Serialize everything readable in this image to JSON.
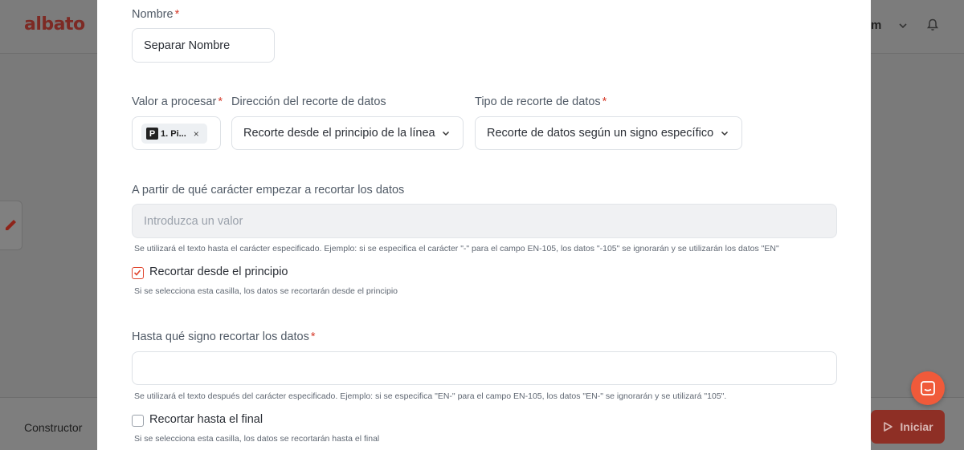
{
  "header": {
    "logo_text": "albato",
    "user_name": "m",
    "icons": [
      "chevron-down-icon",
      "bell-icon"
    ]
  },
  "footer": {
    "builder_label": "Constructor",
    "start_label": "Iniciar"
  },
  "form": {
    "name": {
      "label": "Nombre",
      "required_mark": "*",
      "value": "Separar Nombre"
    },
    "value_to_process": {
      "label": "Valor a procesar",
      "required_mark": "*",
      "chip_icon": "P",
      "chip_text": "1. Pi...",
      "chip_close": "×"
    },
    "cut_direction": {
      "label": "Dirección del recorte de datos",
      "selected": "Recorte desde el principio de la línea"
    },
    "cut_type": {
      "label": "Tipo de recorte de datos",
      "required_mark": "*",
      "selected": "Recorte de datos según un signo específico"
    },
    "start_char": {
      "label": "A partir de qué carácter empezar a recortar los datos",
      "placeholder": "Introduzca un valor",
      "hint": "Se utilizará el texto hasta el carácter especificado. Ejemplo: si se especifica el carácter \"-\" para el campo EN-105, los datos \"-105\" se ignorarán y se utilizarán los datos \"EN\""
    },
    "trim_from_start": {
      "label": "Recortar desde el principio",
      "checked": true,
      "hint": "Si se selecciona esta casilla, los datos se recortarán desde el principio"
    },
    "end_sign": {
      "label": "Hasta qué signo recortar los datos",
      "required_mark": "*",
      "value": "",
      "hint": "Se utilizará el texto después del carácter especificado. Ejemplo: si se especifica \"EN-\" para el campo EN-105, los datos \"EN-\" se ignorarán y se utilizará \"105\"."
    },
    "trim_to_end": {
      "label": "Recortar hasta el final",
      "checked": false,
      "hint": "Si se selecciona esta casilla, los datos se recortarán hasta el final"
    }
  },
  "colors": {
    "accent": "#e0462e",
    "required": "#d63b2b",
    "chat": "#f05a3a"
  }
}
